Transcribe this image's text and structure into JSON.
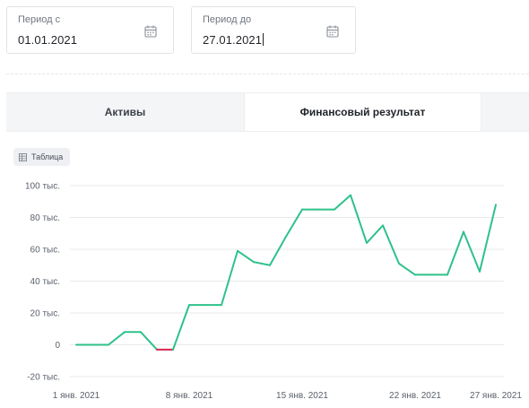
{
  "filters": {
    "from": {
      "label": "Период с",
      "value": "01.01.2021",
      "icon": "calendar-icon"
    },
    "to": {
      "label": "Период до",
      "value": "27.01.2021",
      "icon": "calendar-icon"
    }
  },
  "tabs": [
    {
      "label": "Активы",
      "active": false
    },
    {
      "label": "Финансовый результат",
      "active": true
    }
  ],
  "table_toggle": {
    "label": "Таблица",
    "icon": "table-icon"
  },
  "colors": {
    "positive": "#2ec18a",
    "negative": "#d6264f",
    "grid": "#e7e9ec"
  },
  "chart_data": {
    "type": "line",
    "title": "",
    "xlabel": "",
    "ylabel": "",
    "ylim": [
      -20,
      100
    ],
    "yticks": [
      {
        "value": 100,
        "label": "100 тыс."
      },
      {
        "value": 80,
        "label": "80 тыс."
      },
      {
        "value": 60,
        "label": "60 тыс."
      },
      {
        "value": 40,
        "label": "40 тыс."
      },
      {
        "value": 20,
        "label": "20 тыс."
      },
      {
        "value": 0,
        "label": "0"
      },
      {
        "value": -20,
        "label": "-20 тыс."
      }
    ],
    "xticks": [
      {
        "day": 1,
        "label": "1 янв. 2021"
      },
      {
        "day": 8,
        "label": "8 янв. 2021"
      },
      {
        "day": 15,
        "label": "15 янв. 2021"
      },
      {
        "day": 22,
        "label": "22 янв. 2021"
      },
      {
        "day": 27,
        "label": "27 янв. 2021"
      }
    ],
    "unit": "тыс.",
    "grid": true,
    "legend": "none",
    "series": [
      {
        "x": [
          "01.01.2021",
          "02.01.2021",
          "03.01.2021",
          "04.01.2021",
          "05.01.2021",
          "06.01.2021",
          "07.01.2021",
          "08.01.2021",
          "09.01.2021",
          "10.01.2021",
          "11.01.2021",
          "12.01.2021",
          "13.01.2021",
          "14.01.2021",
          "15.01.2021",
          "16.01.2021",
          "17.01.2021",
          "18.01.2021",
          "19.01.2021",
          "20.01.2021",
          "21.01.2021",
          "22.01.2021",
          "23.01.2021",
          "24.01.2021",
          "25.01.2021",
          "26.01.2021",
          "27.01.2021"
        ],
        "values": [
          0,
          0,
          0,
          8,
          8,
          -3,
          -3,
          25,
          25,
          25,
          59,
          52,
          50,
          68,
          85,
          85,
          85,
          94,
          64,
          75,
          51,
          44,
          44,
          44,
          71,
          46,
          88
        ]
      }
    ]
  }
}
